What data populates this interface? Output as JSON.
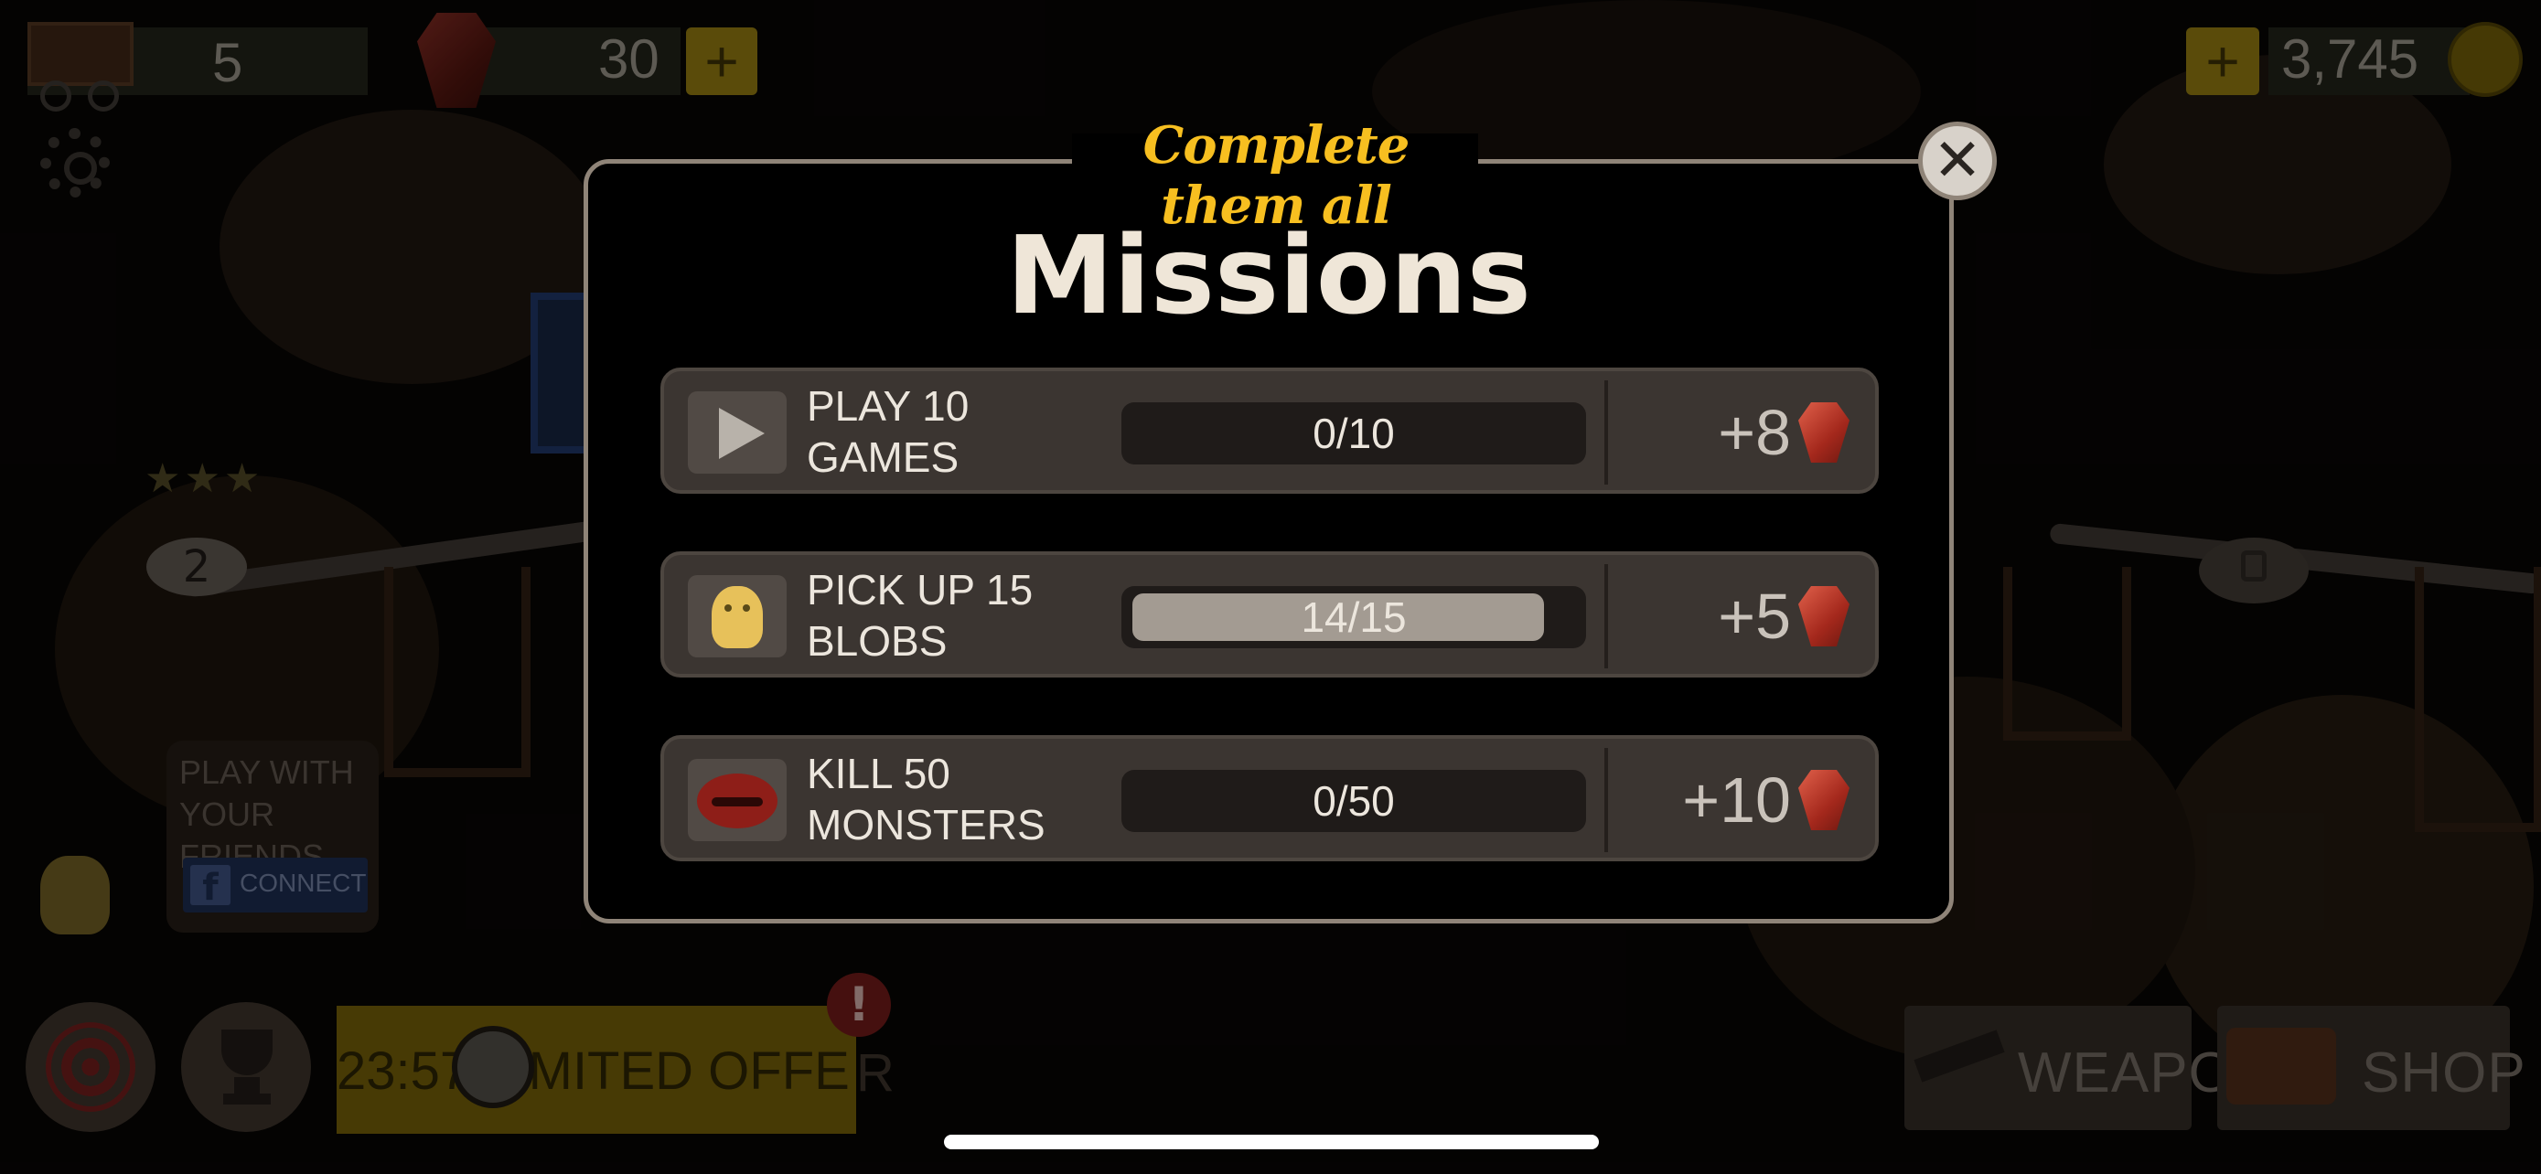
{
  "hud": {
    "carts_count": "5",
    "gems_count": "30",
    "gems_plus_label": "+",
    "coins_plus_label": "+",
    "coins_count": "3,745"
  },
  "level_marker": {
    "number": "2"
  },
  "friends": {
    "text": "PLAY WITH YOUR FRIENDS",
    "fb_letter": "f",
    "connect_label": "CONNECT"
  },
  "offer": {
    "label": "23:57 LIMITED OFFE",
    "overflow": "R",
    "badge": "!"
  },
  "bottom": {
    "weapons_label": "WEAPONS",
    "shop_label": "SHOP"
  },
  "modal": {
    "tagline": "Complete them all",
    "title": "Missions",
    "close_glyph": "✕",
    "missions": [
      {
        "label": "PLAY 10 GAMES",
        "progress_text": "0/10",
        "progress_fraction": 0.0,
        "reward": "+8",
        "icon": "play-icon"
      },
      {
        "label": "PICK UP 15 BLOBS",
        "progress_text": "14/15",
        "progress_fraction": 0.93,
        "reward": "+5",
        "icon": "blob-icon"
      },
      {
        "label": "KILL 50 MONSTERS",
        "progress_text": "0/50",
        "progress_fraction": 0.0,
        "reward": "+10",
        "icon": "monster-icon"
      }
    ]
  },
  "colors": {
    "tagline": "#f7bf20",
    "modal_border": "#8f8478",
    "mission_row": "#3b3531",
    "progress_fill": "#a39b92",
    "gem": "#c83a28"
  }
}
